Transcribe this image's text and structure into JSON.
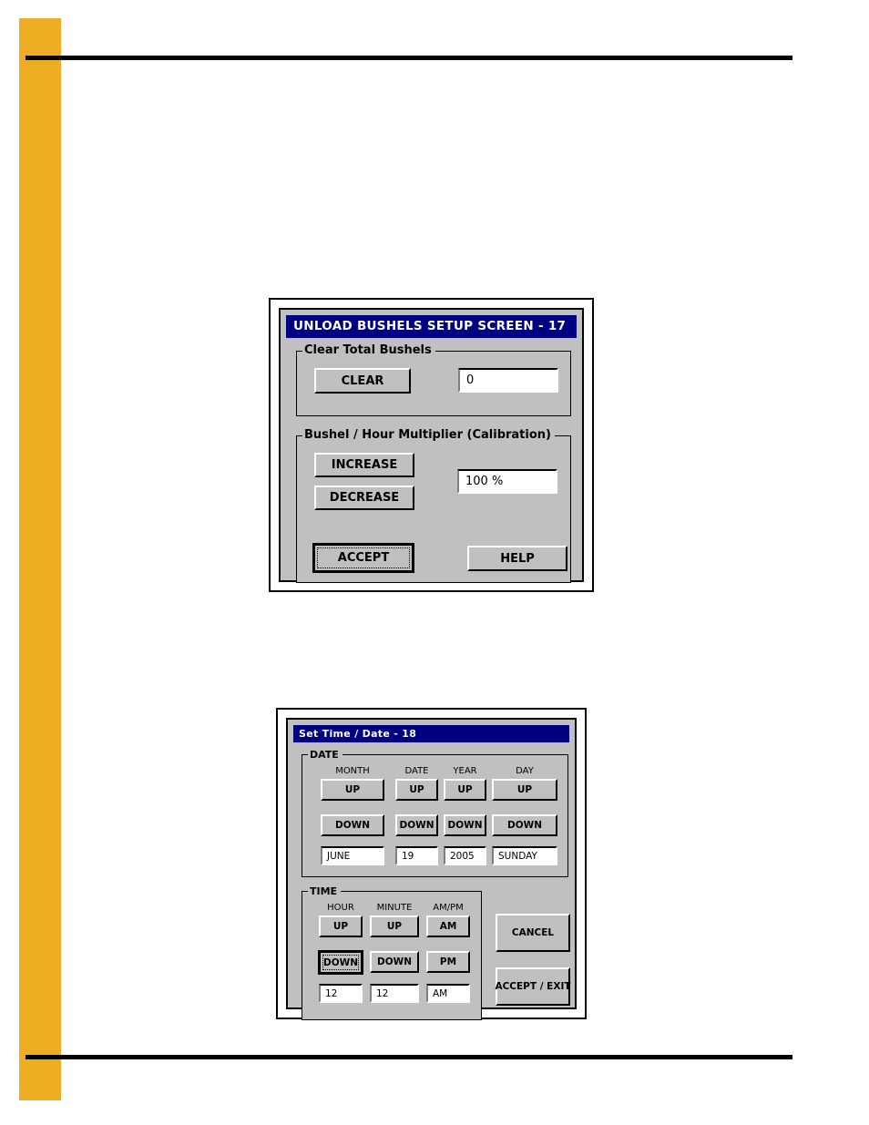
{
  "page": {
    "sidebar_accent_color": "#edae23",
    "rule_color": "#000000"
  },
  "figures": [
    {
      "id": "unload-bushels-setup-screen",
      "titlebar": "UNLOAD BUSHELS SETUP SCREEN - 17",
      "titlebar_color": "#000080",
      "groups": [
        {
          "label": "Clear Total Bushels",
          "buttons": [
            {
              "label": "CLEAR",
              "focused": false
            }
          ],
          "fields": [
            {
              "label": "total-bushels",
              "value": "0"
            }
          ]
        },
        {
          "label": "Bushel / Hour Multiplier (Calibration)",
          "buttons": [
            {
              "label": "INCREASE",
              "focused": false
            },
            {
              "label": "DECREASE",
              "focused": false
            },
            {
              "label": "ACCEPT",
              "focused": true
            },
            {
              "label": "HELP",
              "focused": false
            }
          ],
          "fields": [
            {
              "label": "multiplier-percent",
              "value": "100 %"
            }
          ]
        }
      ]
    },
    {
      "id": "set-time-date-screen",
      "titlebar": "Set Time / Date - 18",
      "titlebar_color": "#000080",
      "groups": [
        {
          "label": "DATE",
          "columns": [
            {
              "caption": "MONTH",
              "up": "UP",
              "down": "DOWN",
              "value": "JUNE"
            },
            {
              "caption": "DATE",
              "up": "UP",
              "down": "DOWN",
              "value": "19"
            },
            {
              "caption": "YEAR",
              "up": "UP",
              "down": "DOWN",
              "value": "2005"
            },
            {
              "caption": "DAY",
              "up": "UP",
              "down": "DOWN",
              "value": "SUNDAY"
            }
          ]
        },
        {
          "label": "TIME",
          "columns": [
            {
              "caption": "HOUR",
              "up": "UP",
              "down": "DOWN",
              "value": "12",
              "down_focused": true
            },
            {
              "caption": "MINUTE",
              "up": "UP",
              "down": "DOWN",
              "value": "12",
              "down_focused": false
            },
            {
              "caption": "AM/PM",
              "up": "AM",
              "down": "PM",
              "value": "AM",
              "down_focused": false
            }
          ]
        }
      ],
      "side_buttons": [
        {
          "label": "CANCEL"
        },
        {
          "label": "ACCEPT / EXIT"
        }
      ]
    }
  ]
}
